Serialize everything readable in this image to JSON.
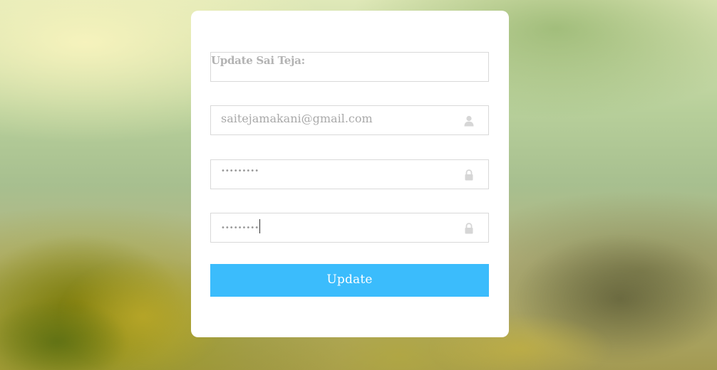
{
  "form": {
    "heading": "Update Sai Teja:",
    "email": {
      "value": "saitejamakani@gmail.com",
      "icon": "user-icon"
    },
    "password": {
      "value": "•••••••••",
      "icon": "lock-icon"
    },
    "confirm_password": {
      "value": "•••••••••",
      "icon": "lock-icon"
    },
    "submit_label": "Update"
  },
  "colors": {
    "button": "#3bbcfc",
    "card": "#ffffff",
    "placeholder_text": "#a9a9a9"
  }
}
